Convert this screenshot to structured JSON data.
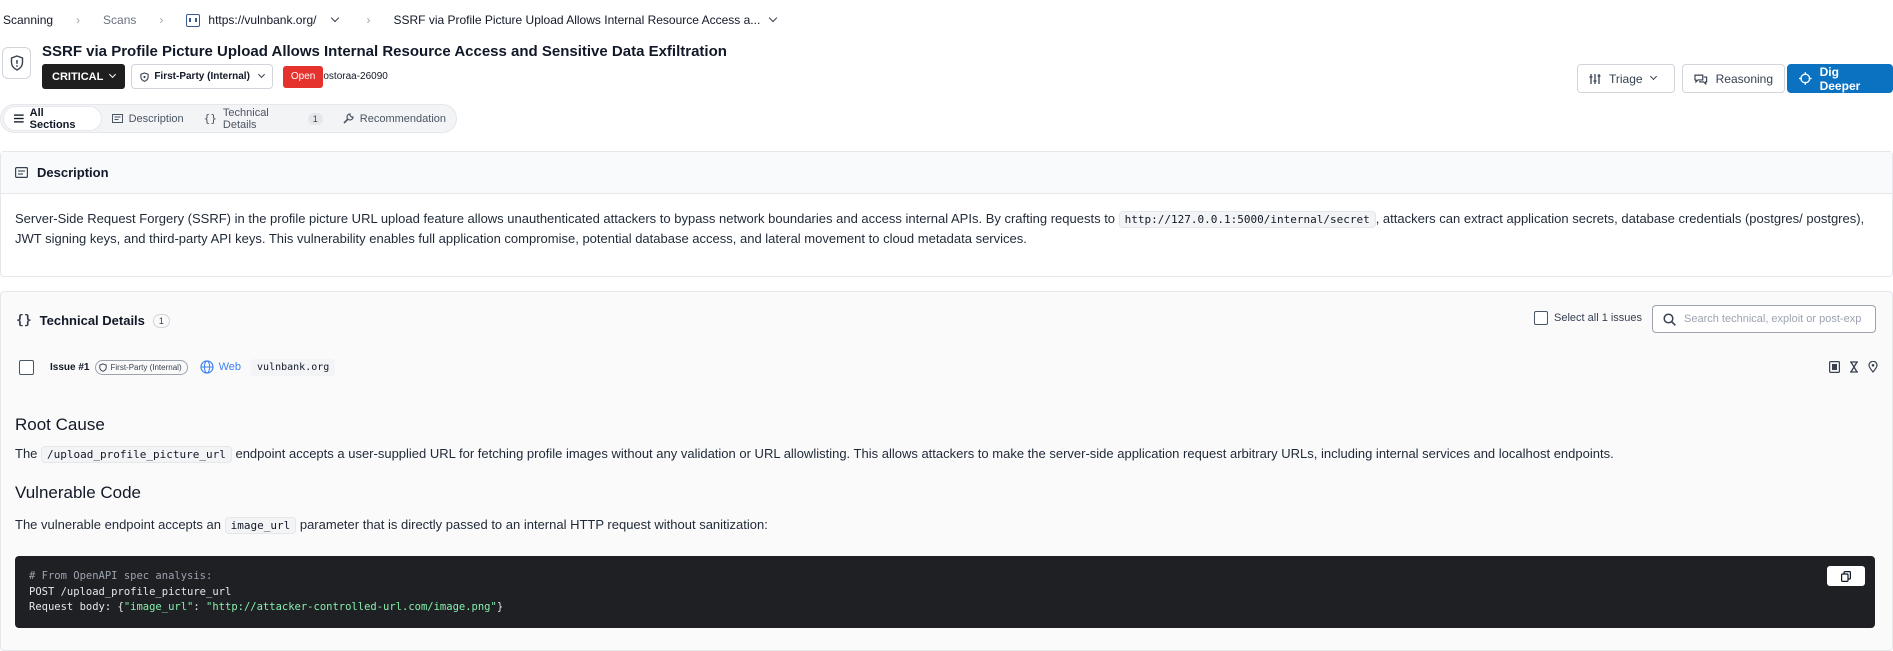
{
  "breadcrumb": {
    "items": [
      "Scanning",
      "Scans",
      "https://vulnbank.org/",
      "SSRF via Profile Picture Upload Allows Internal Resource Access a..."
    ]
  },
  "finding": {
    "title": "SSRF via Profile Picture Upload Allows Internal Resource Access and Sensitive Data Exfiltration",
    "severity": "CRITICAL",
    "scope": "First-Party (Internal)",
    "status": "Open",
    "ticket_id": "ostoraa-26090"
  },
  "actions": {
    "triage": "Triage",
    "reasoning": "Reasoning",
    "dig_deeper": "Dig Deeper"
  },
  "tabs": [
    {
      "label": "All Sections"
    },
    {
      "label": "Description"
    },
    {
      "label": "Technical Details",
      "count": "1"
    },
    {
      "label": "Recommendation"
    }
  ],
  "description": {
    "heading": "Description",
    "text_before": "Server-Side Request Forgery (SSRF) in the profile picture URL upload feature allows unauthenticated attackers to bypass network boundaries and access internal APIs. By crafting requests to",
    "code": "http://127.0.0.1:5000/internal/secret",
    "text_after": ", attackers can extract application secrets, database credentials (postgres/ postgres), JWT signing keys, and third-party API keys. This vulnerability enables full application compromise, potential database access, and lateral movement to cloud metadata services."
  },
  "technical": {
    "heading": "Technical Details",
    "count": "1",
    "select_all": "Select all 1 issues",
    "search_placeholder": "Search technical, exploit or post-exp"
  },
  "issue": {
    "label": "Issue #1",
    "scope": "First-Party (Internal)",
    "type": "Web",
    "host": "vulnbank.org"
  },
  "root_cause": {
    "heading": "Root Cause",
    "before": "The",
    "code": "/upload_profile_picture_url",
    "after": "endpoint accepts a user-supplied URL for fetching profile images without any validation or URL allowlisting. This allows attackers to make the server-side application request arbitrary URLs, including internal services and localhost endpoints."
  },
  "vulnerable_code": {
    "heading": "Vulnerable Code",
    "before": "The vulnerable endpoint accepts an",
    "code": "image_url",
    "after": "parameter that is directly passed to an internal HTTP request without sanitization:",
    "block": {
      "line1": "# From OpenAPI spec analysis:",
      "line2": "POST /upload_profile_picture_url",
      "line3_prefix": "Request body: {",
      "line3_key": "\"image_url\"",
      "line3_colon": ": ",
      "line3_value": "\"http://attacker-controlled-url.com/image.png\"",
      "line3_suffix": "}"
    }
  }
}
